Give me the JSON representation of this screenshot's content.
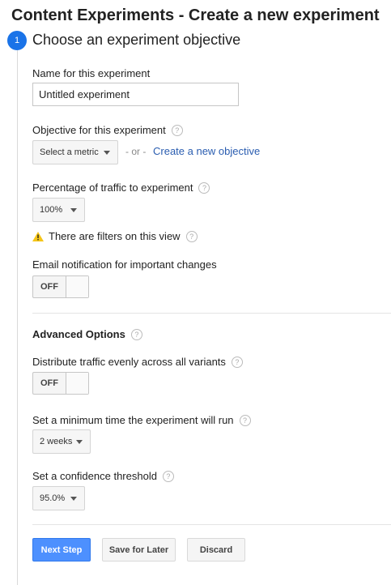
{
  "page_title": "Content Experiments - Create a new experiment",
  "step": {
    "number": "1",
    "title": "Choose an experiment objective"
  },
  "name_field": {
    "label": "Name for this experiment",
    "value": "Untitled experiment"
  },
  "objective": {
    "label": "Objective for this experiment",
    "select_value": "Select a metric",
    "or_text": "- or -",
    "create_link": "Create a new objective"
  },
  "traffic": {
    "label": "Percentage of traffic to experiment",
    "value": "100%"
  },
  "filters_warning": "There are filters on this view",
  "email_notification": {
    "label": "Email notification for important changes",
    "state": "OFF"
  },
  "advanced": {
    "heading": "Advanced Options",
    "distribute": {
      "label": "Distribute traffic evenly across all variants",
      "state": "OFF"
    },
    "min_time": {
      "label": "Set a minimum time the experiment will run",
      "value": "2 weeks"
    },
    "confidence": {
      "label": "Set a confidence threshold",
      "value": "95.0%"
    }
  },
  "buttons": {
    "next": "Next Step",
    "save": "Save for Later",
    "discard": "Discard"
  },
  "icons": {
    "help": "help-icon",
    "warning": "warning-icon",
    "caret": "chevron-down-icon"
  },
  "colors": {
    "primary": "#4d90fe",
    "link": "#2a5db0",
    "step_badge": "#1a73e8",
    "warning": "#f5c518"
  }
}
